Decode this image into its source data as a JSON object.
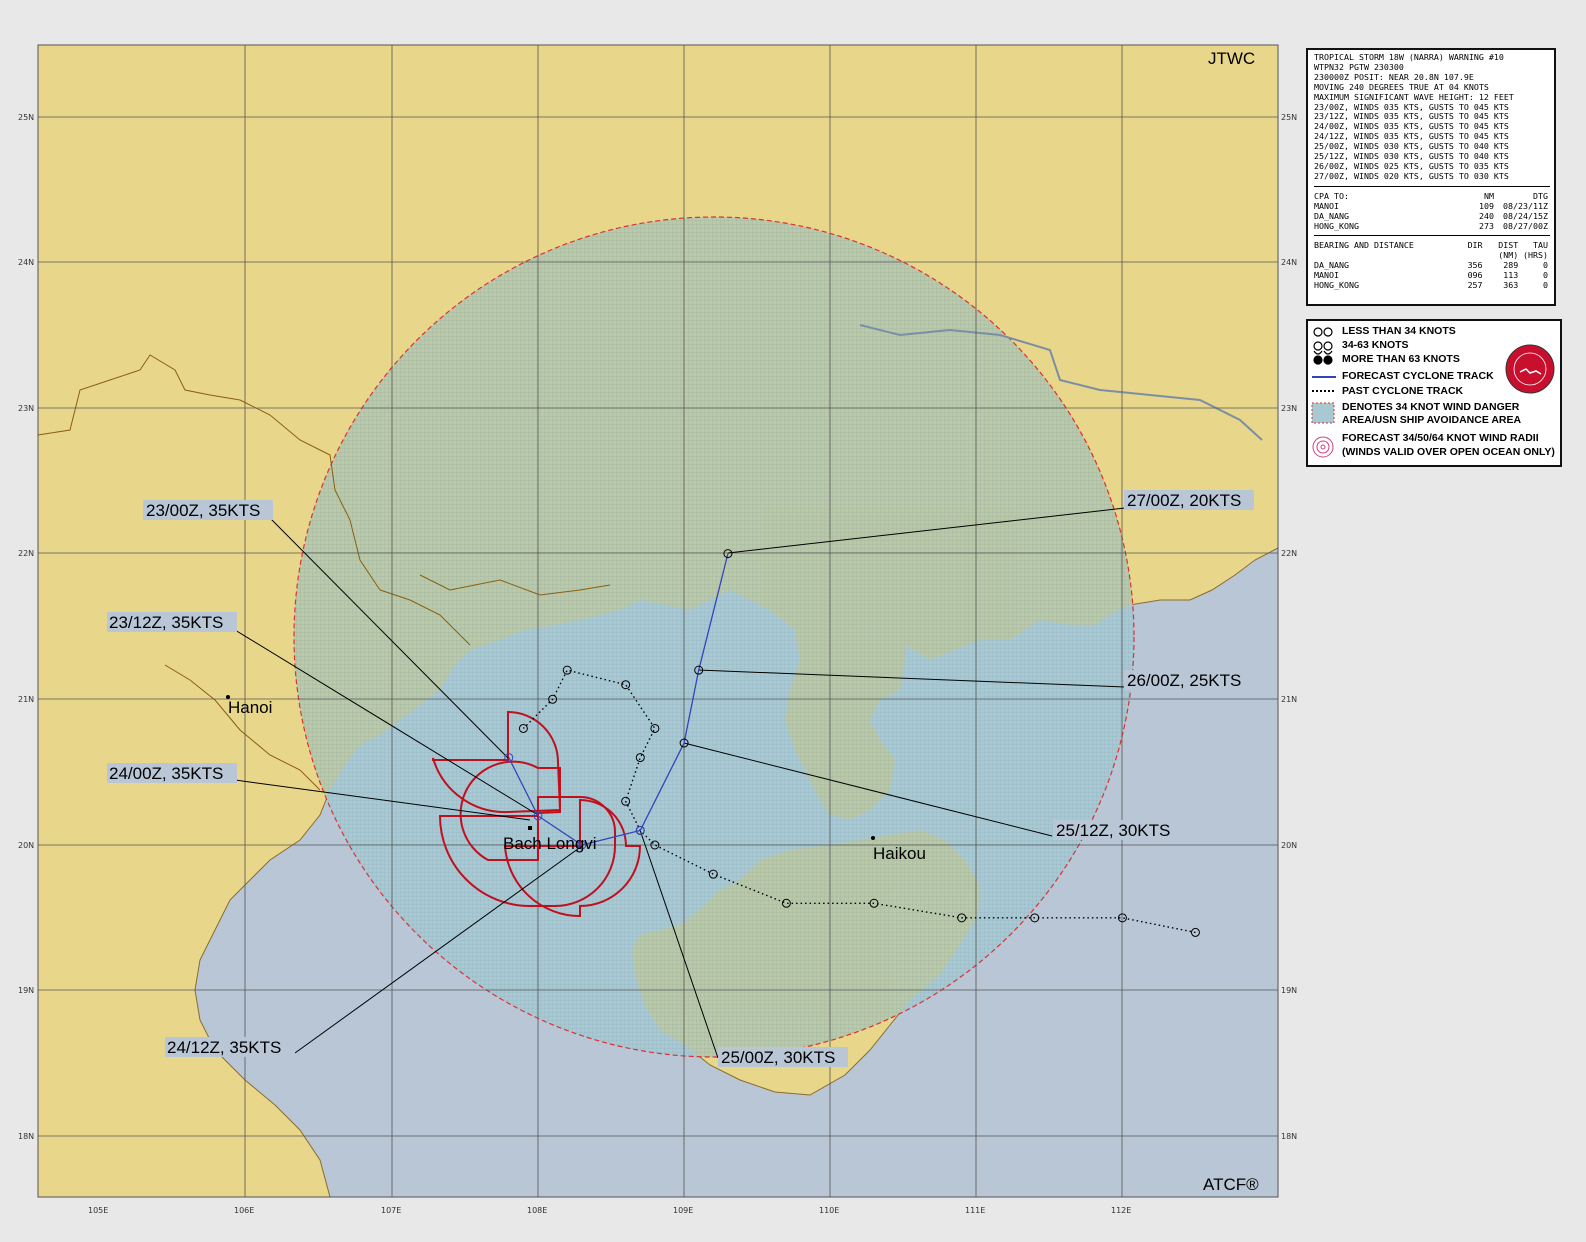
{
  "header": {
    "agency": "JTWC",
    "footer": "ATCF®"
  },
  "colors": {
    "land": "#e8d68a",
    "sea": "#b8c6d6",
    "danger_land": "#d2cc86",
    "danger_sea": "#a9c9d2",
    "danger_edge": "#e03030",
    "radii": "#c0101e",
    "track": "#3344bb",
    "border": "#8b5e10"
  },
  "lat_labels": [
    "25N",
    "24N",
    "23N",
    "22N",
    "21N",
    "20N",
    "19N",
    "18N"
  ],
  "lon_labels": [
    "105E",
    "106E",
    "107E",
    "108E",
    "109E",
    "110E",
    "111E",
    "112E"
  ],
  "places": {
    "hanoi": "Hanoi",
    "haikou": "Haikou",
    "bach_longvi": "Bach Longvi"
  },
  "callouts": [
    {
      "text": "23/00Z,  35KTS"
    },
    {
      "text": "23/12Z,  35KTS"
    },
    {
      "text": "24/00Z,  35KTS"
    },
    {
      "text": "24/12Z,  35KTS"
    },
    {
      "text": "25/00Z,  30KTS"
    },
    {
      "text": "25/12Z,  30KTS"
    },
    {
      "text": "26/00Z,  25KTS"
    },
    {
      "text": "27/00Z,  20KTS"
    }
  ],
  "forecast_track": [
    {
      "time": "23/00Z",
      "lat": 20.6,
      "lon": 107.8,
      "kts": 35
    },
    {
      "time": "23/12Z",
      "lat": 20.2,
      "lon": 108.0,
      "kts": 35
    },
    {
      "time": "24/00Z",
      "lat": 20.0,
      "lon": 108.3,
      "kts": 35
    },
    {
      "time": "24/12Z",
      "lat": 20.1,
      "lon": 108.7,
      "kts": 35
    },
    {
      "time": "25/00Z",
      "lat": 20.7,
      "lon": 109.0,
      "kts": 30
    },
    {
      "time": "25/12Z",
      "lat": 21.2,
      "lon": 109.1,
      "kts": 30
    },
    {
      "time": "26/00Z",
      "lat": 22.0,
      "lon": 109.3,
      "kts": 25
    }
  ],
  "past_track": [
    {
      "lat": 19.4,
      "lon": 112.5
    },
    {
      "lat": 19.5,
      "lon": 112.0
    },
    {
      "lat": 19.5,
      "lon": 111.4
    },
    {
      "lat": 19.5,
      "lon": 110.9
    },
    {
      "lat": 19.6,
      "lon": 110.3
    },
    {
      "lat": 19.6,
      "lon": 109.7
    },
    {
      "lat": 19.8,
      "lon": 109.2
    },
    {
      "lat": 20.0,
      "lon": 108.8
    },
    {
      "lat": 20.1,
      "lon": 108.7
    },
    {
      "lat": 20.3,
      "lon": 108.6
    },
    {
      "lat": 20.6,
      "lon": 108.7
    },
    {
      "lat": 20.8,
      "lon": 108.8
    },
    {
      "lat": 21.1,
      "lon": 108.6
    },
    {
      "lat": 21.2,
      "lon": 108.2
    },
    {
      "lat": 21.0,
      "lon": 108.1
    },
    {
      "lat": 20.8,
      "lon": 107.9
    }
  ],
  "info": {
    "lines": [
      "TROPICAL STORM 18W (NARRA) WARNING #10",
      "WTPN32 PGTW 230300",
      "230000Z POSIT: NEAR 20.8N 107.9E",
      "MOVING 240 DEGREES TRUE AT 04 KNOTS",
      "MAXIMUM SIGNIFICANT WAVE HEIGHT: 12 FEET",
      "23/00Z, WINDS 035 KTS, GUSTS TO 045 KTS",
      "23/12Z, WINDS 035 KTS, GUSTS TO 045 KTS",
      "24/00Z, WINDS 035 KTS, GUSTS TO 045 KTS",
      "24/12Z, WINDS 035 KTS, GUSTS TO 045 KTS",
      "25/00Z, WINDS 030 KTS, GUSTS TO 040 KTS",
      "25/12Z, WINDS 030 KTS, GUSTS TO 040 KTS",
      "26/00Z, WINDS 025 KTS, GUSTS TO 035 KTS",
      "27/00Z, WINDS 020 KTS, GUSTS TO 030 KTS"
    ],
    "cpa_header": [
      "CPA TO:",
      "NM",
      "DTG"
    ],
    "cpa": [
      [
        "MANOI",
        "109",
        "08/23/11Z"
      ],
      [
        "DA_NANG",
        "240",
        "08/24/15Z"
      ],
      [
        "HONG_KONG",
        "273",
        "08/27/00Z"
      ]
    ],
    "bearing_header": [
      "BEARING AND DISTANCE",
      "DIR",
      "DIST",
      "TAU"
    ],
    "bearing_units": [
      "",
      "",
      "(NM)",
      "(HRS)"
    ],
    "bearing": [
      [
        "DA_NANG",
        "356",
        "289",
        "0"
      ],
      [
        "MANOI",
        "096",
        "113",
        "0"
      ],
      [
        "HONG_KONG",
        "257",
        "363",
        "0"
      ]
    ]
  },
  "legend": {
    "items": [
      "LESS THAN 34 KNOTS",
      "34-63 KNOTS",
      "MORE THAN 63 KNOTS",
      "FORECAST CYCLONE TRACK",
      "PAST CYCLONE TRACK",
      "DENOTES 34 KNOT WIND DANGER",
      "AREA/USN SHIP AVOIDANCE AREA",
      "FORECAST 34/50/64 KNOT WIND RADII",
      "(WINDS VALID OVER OPEN OCEAN ONLY)"
    ]
  }
}
